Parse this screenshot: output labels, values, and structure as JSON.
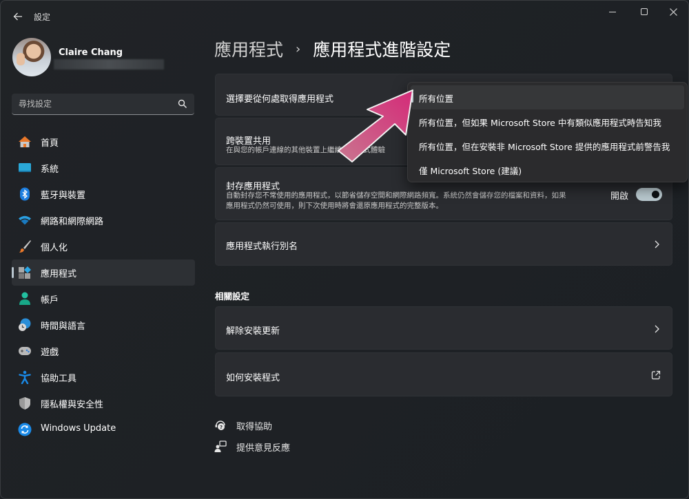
{
  "window": {
    "app_title": "設定",
    "controls": {
      "minimize": "minimize",
      "maximize": "maximize",
      "close": "close"
    }
  },
  "profile": {
    "name": "Claire Chang"
  },
  "search": {
    "placeholder": "尋找設定"
  },
  "sidebar": {
    "items": [
      {
        "label": "首頁",
        "icon": "home-icon"
      },
      {
        "label": "系統",
        "icon": "system-display-icon"
      },
      {
        "label": "藍牙與裝置",
        "icon": "bluetooth-icon"
      },
      {
        "label": "網路和網際網路",
        "icon": "wifi-icon"
      },
      {
        "label": "個人化",
        "icon": "paintbrush-icon"
      },
      {
        "label": "應用程式",
        "icon": "apps-icon",
        "active": true
      },
      {
        "label": "帳戶",
        "icon": "account-icon"
      },
      {
        "label": "時間與語言",
        "icon": "time-language-icon"
      },
      {
        "label": "遊戲",
        "icon": "gamepad-icon"
      },
      {
        "label": "協助工具",
        "icon": "accessibility-icon"
      },
      {
        "label": "隱私權與安全性",
        "icon": "shield-icon"
      },
      {
        "label": "Windows Update",
        "icon": "update-icon"
      }
    ]
  },
  "header": {
    "parent": "應用程式",
    "separator": "›",
    "title": "應用程式進階設定"
  },
  "settings": {
    "choose_source": {
      "title": "選擇要從何處取得應用程式"
    },
    "share_across_devices": {
      "title": "跨裝置共用",
      "subtitle": "在與您的帳戶連線的其他裝置上繼續應用程式體驗"
    },
    "archive_apps": {
      "title": "封存應用程式",
      "subtitle_line1": "自動封存您不常使用的應用程式，以節省儲存空間和網際網路頻寬。系統仍然會儲存您的檔案和資料，如果",
      "subtitle_line2": "應用程式仍然可使用，則下次使用時將會還原應用程式的完整版本。",
      "toggle_label": "開啟",
      "toggle_on": true
    },
    "app_execution_aliases": {
      "title": "應用程式執行別名"
    }
  },
  "related": {
    "heading": "相關設定",
    "uninstall_updates": "解除安裝更新",
    "how_to_install": "如何安裝程式"
  },
  "footer": {
    "get_help": "取得協助",
    "give_feedback": "提供意見反應"
  },
  "dropdown": {
    "selected_index": 0,
    "options": [
      "所有位置",
      "所有位置，但如果 Microsoft Store 中有類似應用程式時告知我",
      "所有位置，但在安裝非 Microsoft Store 提供的應用程式前警告我",
      "僅 Microsoft Store (建議)"
    ]
  },
  "colors": {
    "accent": "#b9c9cf",
    "annotation_arrow": "#d63a7f"
  }
}
